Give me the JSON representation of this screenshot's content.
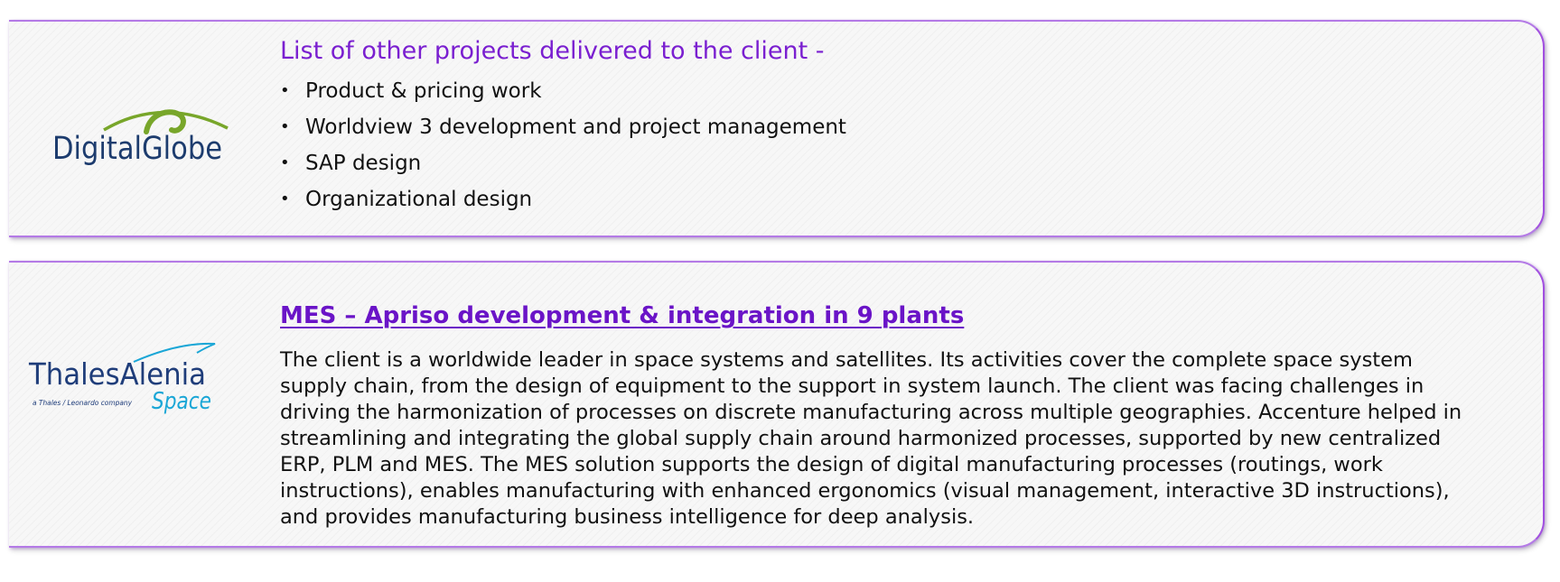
{
  "cards": [
    {
      "logo": {
        "text": "DigitalGlobe",
        "icon": "digitalglobe-arc-logo",
        "colors": {
          "text": "#1d3c6e",
          "arc": "#78a62a"
        }
      },
      "headline": "List of other projects delivered to the client -",
      "bullet": "•",
      "items": [
        "Product & pricing work",
        "Worldview 3 development and project management",
        "SAP design",
        "Organizational design"
      ]
    },
    {
      "logo": {
        "text_main": "ThalesAlenia",
        "text_sub": "Space",
        "tagline": "a Thales / Leonardo company",
        "icon": "thales-alenia-swoosh-logo",
        "colors": {
          "text": "#1f3d7a",
          "accent": "#1aa6d6"
        }
      },
      "title": "MES – Apriso development & integration in 9 plants",
      "body": "The client is a worldwide leader in space systems and satellites. Its activities cover the complete space system supply chain, from the design of equipment to the support in system launch. The client was facing challenges in driving the harmonization of processes on discrete manufacturing across multiple geographies. Accenture helped in streamlining and integrating the global supply chain around harmonized processes, supported by new centralized ERP, PLM and MES. The MES solution supports the design of digital manufacturing processes (routings, work instructions), enables manufacturing with enhanced ergonomics (visual management, interactive 3D instructions), and provides manufacturing business intelligence for deep analysis."
    }
  ],
  "colors": {
    "accent_purple": "#7a1fd0",
    "card_border": "#a24fe0",
    "card_background": "#f7f7f7"
  }
}
